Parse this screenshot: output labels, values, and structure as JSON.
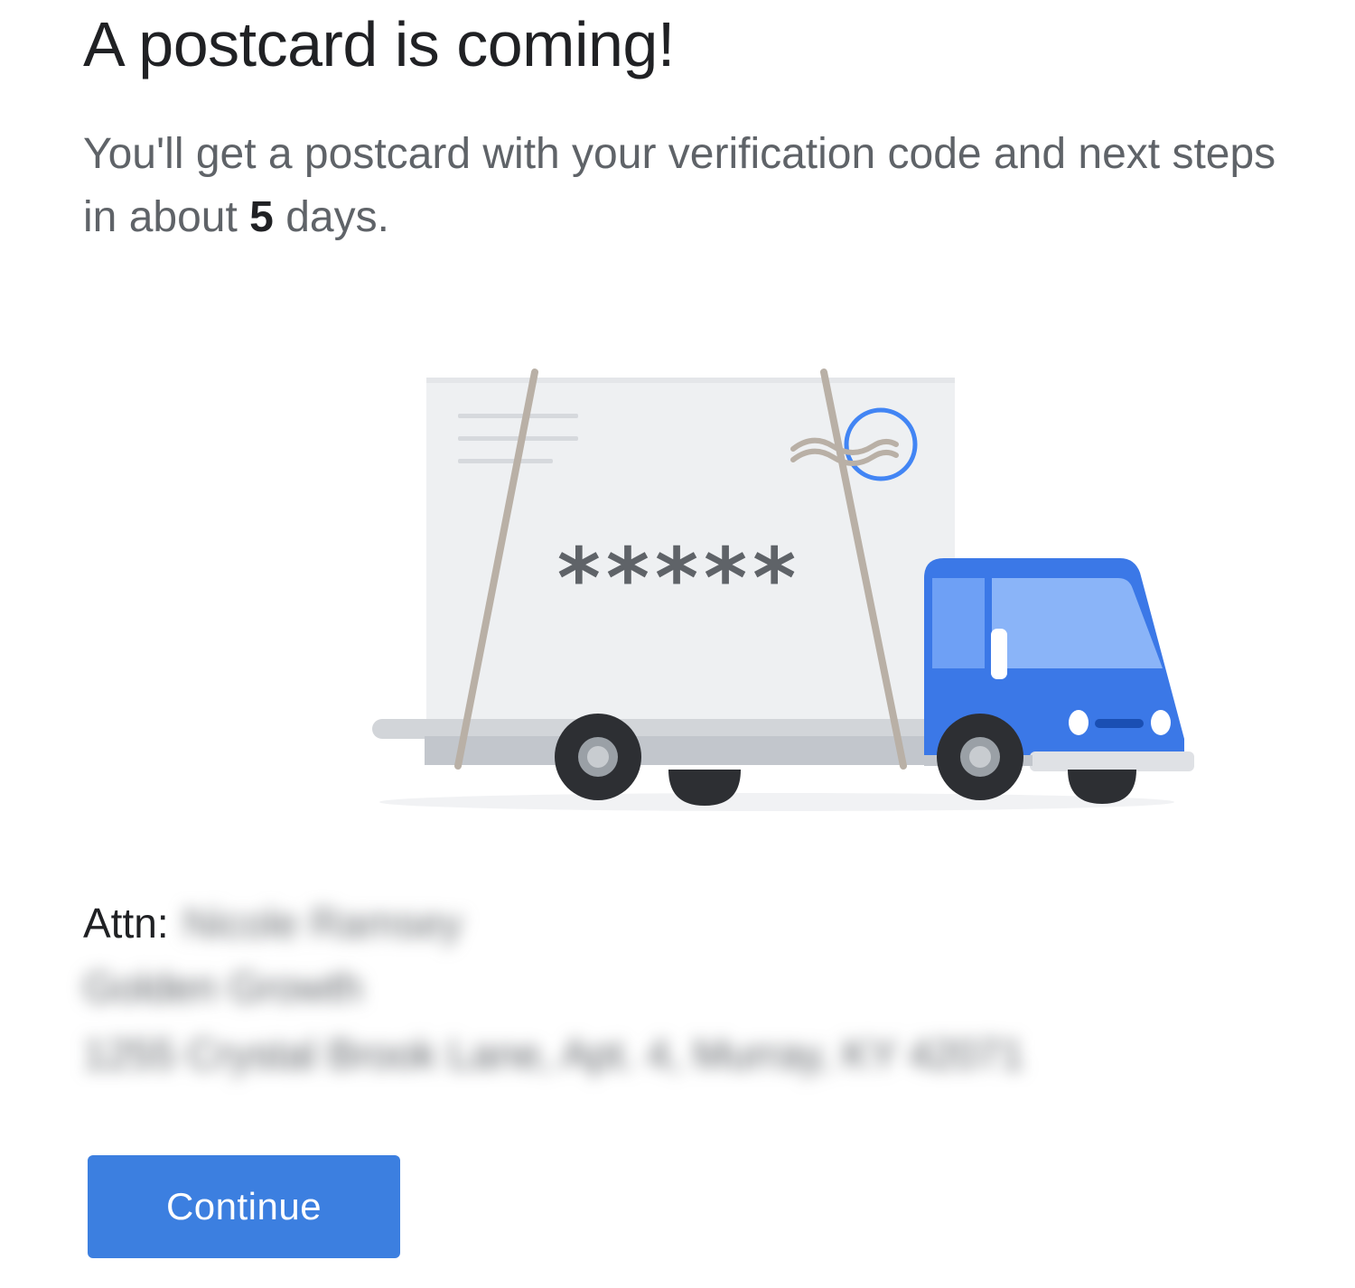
{
  "header": {
    "title": "A postcard is coming!",
    "subtitle_prefix": "You'll get a postcard with your verification code and next steps in about ",
    "subtitle_days": "5",
    "subtitle_suffix": " days."
  },
  "illustration": {
    "icon": "delivery-truck-postcard-icon",
    "code_mask": "*****",
    "colors": {
      "truck_blue": "#3b78e7",
      "postcard": "#eef0f2",
      "strap": "#b9b0a6",
      "tire": "#2d2f33"
    }
  },
  "address": {
    "attn_label": "Attn:",
    "attn_name": "Nicole Ramsey",
    "line1": "Golden Growth",
    "line2": "1255 Crystal Brook Lane, Apt. 4, Murray, KY 42071"
  },
  "actions": {
    "continue_label": "Continue",
    "continue_color": "#3c7fe0"
  }
}
